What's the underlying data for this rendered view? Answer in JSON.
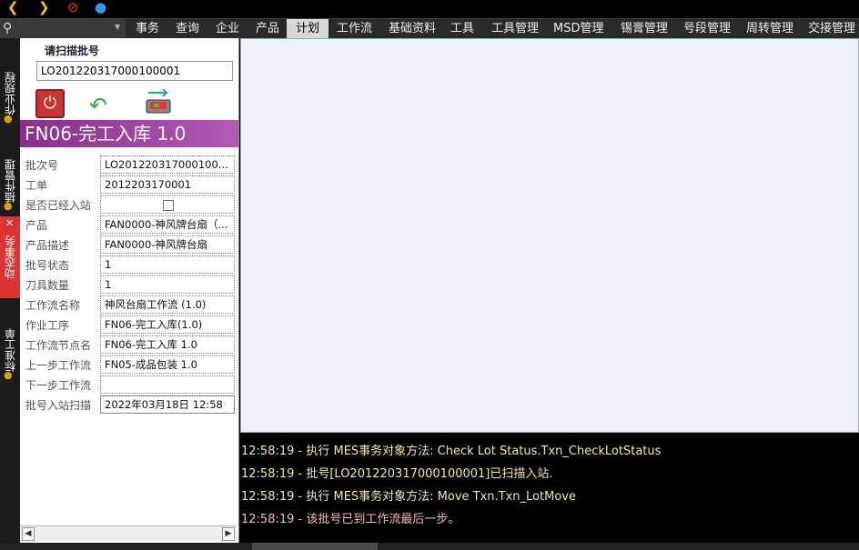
{
  "toolbar": {
    "icons": [
      "arrow-left-icon",
      "arrow-right-icon",
      "stop-icon",
      "user-icon"
    ]
  },
  "menu": {
    "items": [
      "事务",
      "查询",
      "企业",
      "产品",
      "计划",
      "工作流",
      "基础资料",
      "工具",
      "工具管理",
      "MSD管理",
      "锡膏管理",
      "号段管理",
      "周转管理",
      "交接管理"
    ],
    "active": "计划"
  },
  "rail": {
    "tabs": [
      "作业规程",
      "插件管理",
      "动态事务",
      "标准工单"
    ],
    "active": "动态事务"
  },
  "scan": {
    "label": "请扫描批号",
    "value": "LO201220317000100001"
  },
  "form": {
    "title": "FN06-完工入库 1.0"
  },
  "properties": [
    {
      "label": "批次号",
      "value": "LO201220317000100..."
    },
    {
      "label": "工单",
      "value": "2012203170001"
    },
    {
      "label": "是否已经入站",
      "value": "",
      "checkbox": true
    },
    {
      "label": "产品",
      "value": "FAN0000-神风牌台扇（..."
    },
    {
      "label": "产品描述",
      "value": "FAN0000-神风牌台扇"
    },
    {
      "label": "批号状态",
      "value": "1"
    },
    {
      "label": "刀具数量",
      "value": "1"
    },
    {
      "label": "工作流名称",
      "value": "神风台扇工作流 (1.0)"
    },
    {
      "label": "作业工序",
      "value": "FN06-完工入库(1.0)"
    },
    {
      "label": "工作流节点名",
      "value": "FN06-完工入库 1.0"
    },
    {
      "label": "上一步工作流",
      "value": "FN05-成品包装 1.0"
    },
    {
      "label": "下一步工作流",
      "value": ""
    },
    {
      "label": "批号入站扫描",
      "value": "2022年03月18日 12:58"
    }
  ],
  "log": [
    "12:58:19 - 执行 MES事务对象方法: Check Lot Status.Txn_CheckLotStatus",
    "12:58:19 - 批号[LO201220317000100001]已扫描入站.",
    "12:58:19 - 执行 MES事务对象方法: Move Txn.Txn_LotMove",
    "12:58:19 - 该批号已到工作流最后一步。"
  ],
  "colors": {
    "title_gradient_start": "#8a2d8c",
    "log_text": "#f4e7a2",
    "active_rail": "#d33"
  }
}
